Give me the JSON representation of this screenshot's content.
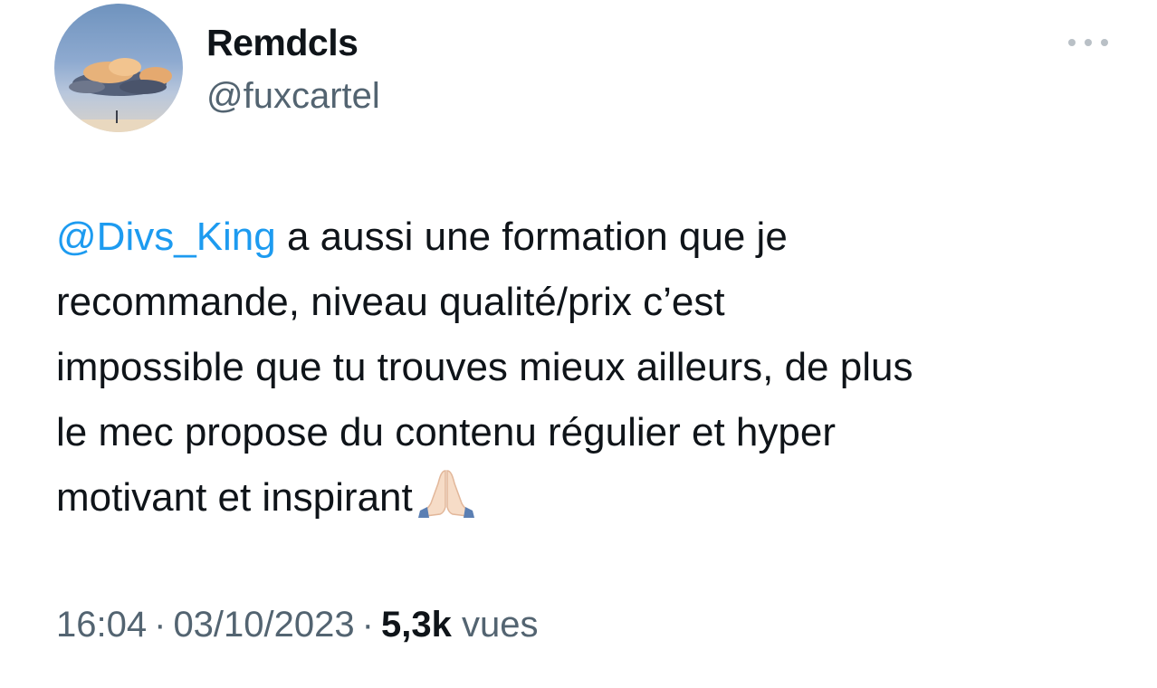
{
  "author": {
    "display_name": "Remdcls",
    "handle": "@fuxcartel",
    "avatar_icon": "sky-clouds-avatar"
  },
  "tweet": {
    "mention": "@Divs_King",
    "lines": [
      " a aussi une formation que je",
      "recommande, niveau qualité/prix c’est",
      "impossible que tu trouves mieux ailleurs, de plus",
      "le mec propose du contenu régulier et hyper",
      "motivant et inspirant"
    ],
    "emoji": "folded-hands-icon"
  },
  "meta": {
    "time": "16:04",
    "separator": "·",
    "date": "03/10/2023",
    "views_count": "5,3k",
    "views_label": "vues"
  },
  "colors": {
    "text": "#0f1419",
    "secondary": "#536471",
    "link": "#1d9bf0"
  }
}
